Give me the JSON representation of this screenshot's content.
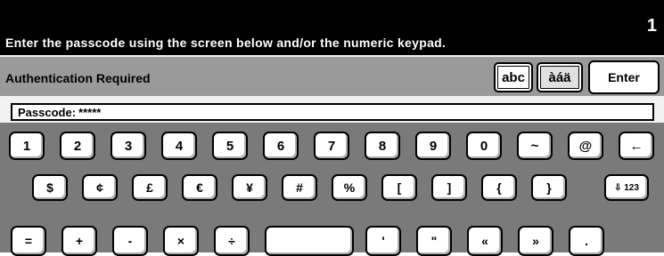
{
  "header": {
    "instruction": "Enter the passcode using the screen below and/or the numeric keypad.",
    "counter": "1"
  },
  "auth_bar": {
    "title": "Authentication Required",
    "mode_abc": "abc",
    "mode_accents": "àáä",
    "enter_label": "Enter"
  },
  "passcode": {
    "label": "Passcode:",
    "value": "*****"
  },
  "keyboard": {
    "row1": [
      "1",
      "2",
      "3",
      "4",
      "5",
      "6",
      "7",
      "8",
      "9",
      "0",
      "~",
      "@",
      "←"
    ],
    "row2": [
      "$",
      "¢",
      "£",
      "€",
      "¥",
      "#",
      "%",
      "[",
      "]",
      "{",
      "}",
      "⇩ 123"
    ],
    "row3": [
      "=",
      "+",
      "-",
      "×",
      "÷",
      " ",
      "'",
      "\"",
      "«",
      "»",
      "."
    ]
  }
}
